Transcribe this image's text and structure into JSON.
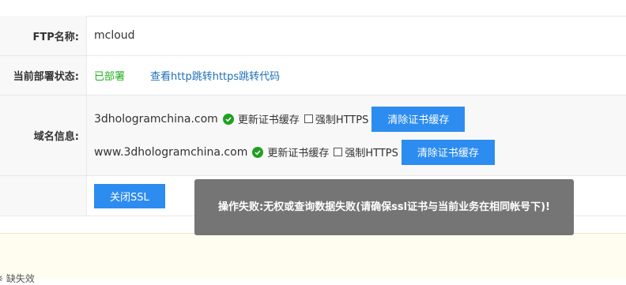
{
  "ftp": {
    "label": "FTP名称:",
    "value": "mcloud"
  },
  "deploy": {
    "label": "当前部署状态:",
    "status": "已部署",
    "link": "查看http跳转https跳转代码",
    "status_color": "#20b020"
  },
  "domains": {
    "label": "域名信息:",
    "items": [
      {
        "name": "3dhologramchina.com",
        "update_cache": "更新证书缓存",
        "force_https": "强制HTTPS",
        "clear_button": "清除证书缓存"
      },
      {
        "name": "www.3dhologramchina.com",
        "update_cache": "更新证书缓存",
        "force_https": "强制HTTPS",
        "clear_button": "清除证书缓存"
      }
    ]
  },
  "actions": {
    "close_ssl": "关闭SSL"
  },
  "toast": {
    "message": "操作失败:无权或查询数据失败(请确保ssl证书与当前业务在相同帐号下)!"
  },
  "footer": {
    "partial_text": "※ 缺失效"
  },
  "colors": {
    "primary_button": "#2d8cf0",
    "link": "#1d6fb8"
  }
}
